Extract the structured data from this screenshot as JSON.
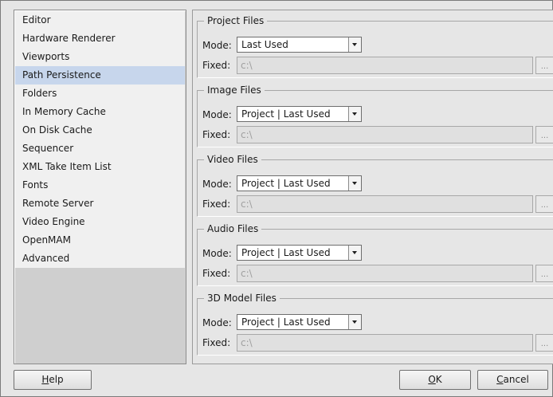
{
  "sidebar": {
    "items": [
      {
        "label": "Editor"
      },
      {
        "label": "Hardware Renderer"
      },
      {
        "label": "Viewports"
      },
      {
        "label": "Path Persistence",
        "selected": true
      },
      {
        "label": "Folders"
      },
      {
        "label": "In Memory Cache"
      },
      {
        "label": "On Disk Cache"
      },
      {
        "label": "Sequencer"
      },
      {
        "label": "XML Take Item List"
      },
      {
        "label": "Fonts"
      },
      {
        "label": "Remote Server"
      },
      {
        "label": "Video Engine"
      },
      {
        "label": "OpenMAM"
      },
      {
        "label": "Advanced"
      }
    ]
  },
  "groups": [
    {
      "title": "Project Files",
      "mode_label": "Mode:",
      "mode_value": "Last Used",
      "fixed_label": "Fixed:",
      "fixed_value": "c:\\",
      "browse_label": "..."
    },
    {
      "title": "Image Files",
      "mode_label": "Mode:",
      "mode_value": "Project | Last Used",
      "fixed_label": "Fixed:",
      "fixed_value": "c:\\",
      "browse_label": "..."
    },
    {
      "title": "Video Files",
      "mode_label": "Mode:",
      "mode_value": "Project | Last Used",
      "fixed_label": "Fixed:",
      "fixed_value": "c:\\",
      "browse_label": "..."
    },
    {
      "title": "Audio Files",
      "mode_label": "Mode:",
      "mode_value": "Project | Last Used",
      "fixed_label": "Fixed:",
      "fixed_value": "c:\\",
      "browse_label": "..."
    },
    {
      "title": "3D Model Files",
      "mode_label": "Mode:",
      "mode_value": "Project | Last Used",
      "fixed_label": "Fixed:",
      "fixed_value": "c:\\",
      "browse_label": "..."
    }
  ],
  "buttons": {
    "help": {
      "mnemonic": "H",
      "rest": "elp"
    },
    "ok": {
      "mnemonic": "O",
      "rest": "K"
    },
    "cancel": {
      "mnemonic": "C",
      "rest": "ancel"
    }
  }
}
